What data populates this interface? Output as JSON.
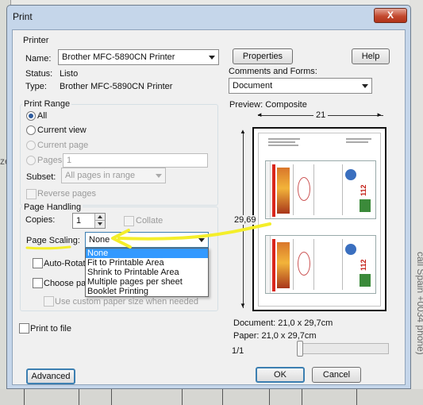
{
  "dialog": {
    "title": "Print",
    "close_label": "X"
  },
  "printer": {
    "group_label": "Printer",
    "name_label": "Name:",
    "name_value": "Brother MFC-5890CN Printer",
    "status_label": "Status:",
    "status_value": "Listo",
    "type_label": "Type:",
    "type_value": "Brother MFC-5890CN Printer",
    "properties_button": "Properties",
    "help_button": "Help",
    "comments_label": "Comments and Forms:",
    "comments_value": "Document"
  },
  "print_range": {
    "group_label": "Print Range",
    "all_label": "All",
    "current_view_label": "Current view",
    "current_page_label": "Current page",
    "pages_label": "Pages",
    "pages_value": "1",
    "subset_label": "Subset:",
    "subset_value": "All pages in range",
    "reverse_pages_label": "Reverse pages"
  },
  "page_handling": {
    "group_label": "Page Handling",
    "copies_label": "Copies:",
    "copies_value": "1",
    "collate_label": "Collate",
    "page_scaling_label": "Page Scaling:",
    "page_scaling_value": "None",
    "scaling_options": [
      "None",
      "Fit to Printable Area",
      "Shrink to Printable Area",
      "Multiple pages per sheet",
      "Booklet Printing"
    ],
    "auto_rotate_label": "Auto-Rotate",
    "choose_paper_label": "Choose pape",
    "custom_paper_label": "Use custom paper size when needed"
  },
  "print_to_file_label": "Print to file",
  "preview": {
    "group_label": "Preview: Composite",
    "width_label": "21",
    "height_label": "29,69",
    "document_size": "Document: 21,0 x 29,7cm",
    "paper_size": "Paper: 21,0 x 29,7cm",
    "page_indicator": "1/1",
    "label_number": "112"
  },
  "buttons": {
    "advanced": "Advanced",
    "ok": "OK",
    "cancel": "Cancel"
  },
  "background": {
    "left_fragment": "ze",
    "right_vertical_text": "call Spain +0034 phone)"
  },
  "colors": {
    "highlight_arrow": "#f4ee2a",
    "selection": "#3399ff",
    "close_button": "#c3492f"
  }
}
